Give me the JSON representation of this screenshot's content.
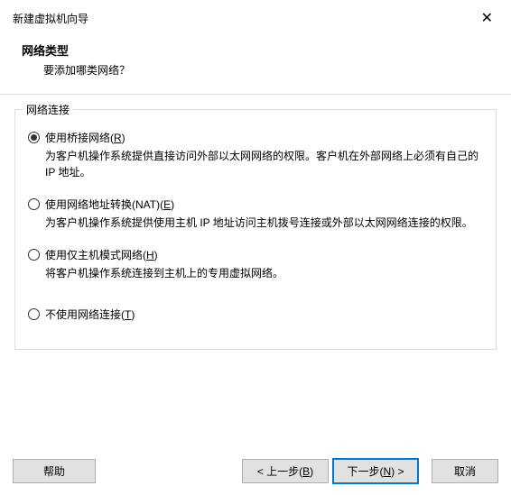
{
  "window": {
    "title": "新建虚拟机向导"
  },
  "header": {
    "title": "网络类型",
    "subtitle": "要添加哪类网络？"
  },
  "group": {
    "legend": "网络连接"
  },
  "options": {
    "bridged": {
      "label_pre": "使用桥接网络(",
      "mnemonic": "R",
      "label_post": ")",
      "desc": "为客户机操作系统提供直接访问外部以太网网络的权限。客户机在外部网络上必须有自己的 IP 地址。"
    },
    "nat": {
      "label_pre": "使用网络地址转换(NAT)(",
      "mnemonic": "E",
      "label_post": ")",
      "desc": "为客户机操作系统提供使用主机 IP 地址访问主机拨号连接或外部以太网网络连接的权限。"
    },
    "hostonly": {
      "label_pre": "使用仅主机模式网络(",
      "mnemonic": "H",
      "label_post": ")",
      "desc": "将客户机操作系统连接到主机上的专用虚拟网络。"
    },
    "none": {
      "label_pre": "不使用网络连接(",
      "mnemonic": "T",
      "label_post": ")"
    }
  },
  "buttons": {
    "help": "帮助",
    "back_pre": "< 上一步(",
    "back_mn": "B",
    "back_post": ")",
    "next_pre": "下一步(",
    "next_mn": "N",
    "next_post": ") >",
    "cancel": "取消"
  }
}
